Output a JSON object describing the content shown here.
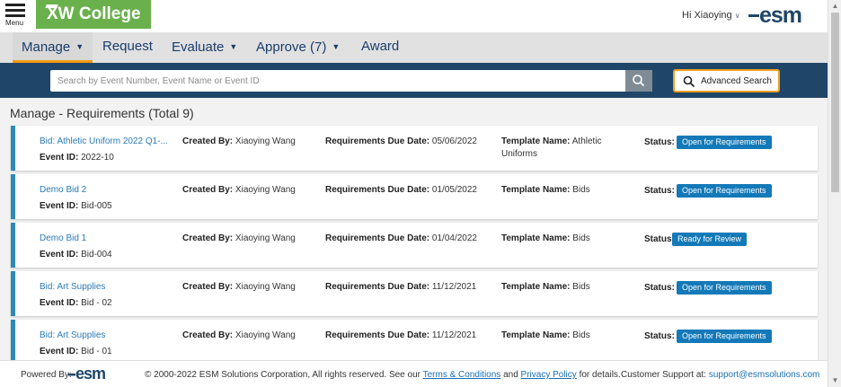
{
  "header": {
    "menu_label": "Menu",
    "college_name": "XW College",
    "user_greeting": "Hi Xiaoying",
    "brand": "esm"
  },
  "nav": {
    "items": [
      {
        "label": "Manage",
        "dropdown": true,
        "active": true
      },
      {
        "label": "Request",
        "dropdown": false,
        "active": false
      },
      {
        "label": "Evaluate",
        "dropdown": true,
        "active": false
      },
      {
        "label": "Approve (7)",
        "dropdown": true,
        "active": false
      },
      {
        "label": "Award",
        "dropdown": false,
        "active": false
      }
    ]
  },
  "search": {
    "placeholder": "Search by Event Number, Event Name or Event ID",
    "value": "",
    "advanced_label": "Advanced Search"
  },
  "page": {
    "section": "Manage",
    "separator": " - ",
    "subsection": "Requirements",
    "total": "(Total 9)"
  },
  "labels": {
    "event_id": "Event ID:",
    "created_by": "Created By:",
    "due_date": "Requirements Due Date:",
    "template": "Template Name:",
    "status": "Status:"
  },
  "events": [
    {
      "title": "Bid: Athletic Uniform 2022 Q1-...",
      "event_id": "2022-10",
      "created_by": "Xiaoying Wang",
      "due_date": "05/06/2022",
      "template": "Athletic Uniforms",
      "status": "Open for Requirements"
    },
    {
      "title": "Demo Bid 2",
      "event_id": "Bid-005",
      "created_by": "Xiaoying Wang",
      "due_date": "01/05/2022",
      "template": "Bids",
      "status": "Open for Requirements"
    },
    {
      "title": "Demo Bid 1",
      "event_id": "Bid-004",
      "created_by": "Xiaoying Wang",
      "due_date": "01/04/2022",
      "template": "Bids",
      "status": "Ready for Review"
    },
    {
      "title": "Bid: Art Supplies",
      "event_id": "Bid - 02",
      "created_by": "Xiaoying Wang",
      "due_date": "11/12/2021",
      "template": "Bids",
      "status": "Open for Requirements"
    },
    {
      "title": "Bid: Art Supplies",
      "event_id": "Bid - 01",
      "created_by": "Xiaoying Wang",
      "due_date": "11/12/2021",
      "template": "Bids",
      "status": "Open for Requirements"
    }
  ],
  "footer": {
    "powered_by": "Powered By:",
    "copyright_prefix": "© 2000-2022 ESM Solutions Corporation, All rights reserved. See our",
    "terms": "Terms & Conditions",
    "and": "and",
    "privacy": "Privacy Policy",
    "suffix": "for details.",
    "support_label": "Customer Support at:",
    "support_email": "support@esmsolutions.com"
  },
  "colors": {
    "accent": "#f39c12",
    "nav_text": "#1a3c6e",
    "search_bar": "#1f4668",
    "college_green": "#6ab04c",
    "badge": "#1479b8",
    "card_border": "#2a8ab8"
  }
}
